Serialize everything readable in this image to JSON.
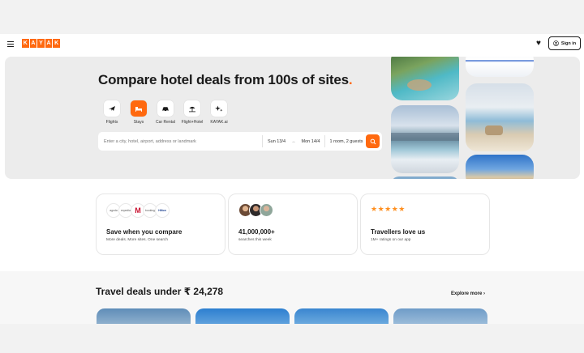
{
  "header": {
    "logo_letters": [
      "K",
      "A",
      "Y",
      "A",
      "K"
    ],
    "signin_label": "Sign in"
  },
  "hero": {
    "title": "Compare hotel deals from 100s of sites",
    "title_dot": ".",
    "verticals": [
      {
        "label": "Flights",
        "icon": "plane-icon",
        "active": false
      },
      {
        "label": "Stays",
        "icon": "bed-icon",
        "active": true
      },
      {
        "label": "Car Rental",
        "icon": "car-icon",
        "active": false
      },
      {
        "label": "Flight+Hotel",
        "icon": "beach-umbrella-icon",
        "active": false
      },
      {
        "label": "KAYAK.ai",
        "icon": "sparkle-icon",
        "active": false
      }
    ],
    "search": {
      "destination_placeholder": "Enter a city, hotel, airport, address or landmark",
      "checkin": "Sun 13/4",
      "arrow": "↔",
      "checkout": "Mon 14/4",
      "guests": "1 room, 2 guests"
    }
  },
  "features": [
    {
      "title": "Save when you compare",
      "subtitle": "More deals. More sites. One search",
      "partner_logos": [
        "agoda",
        "expedia",
        "M",
        "booking",
        "Hilton"
      ]
    },
    {
      "title": "41,000,000+",
      "subtitle": "searches this week"
    },
    {
      "title": "Travellers love us",
      "subtitle": "1M+ ratings on our app",
      "stars": "★★★★★"
    }
  ],
  "deals": {
    "title": "Travel deals under ₹ 24,278",
    "explore_label": "Explore more",
    "explore_chevron": "›"
  },
  "colors": {
    "brand": "#ff690f",
    "star": "#ff8f1f",
    "text": "#1a1a1a"
  }
}
